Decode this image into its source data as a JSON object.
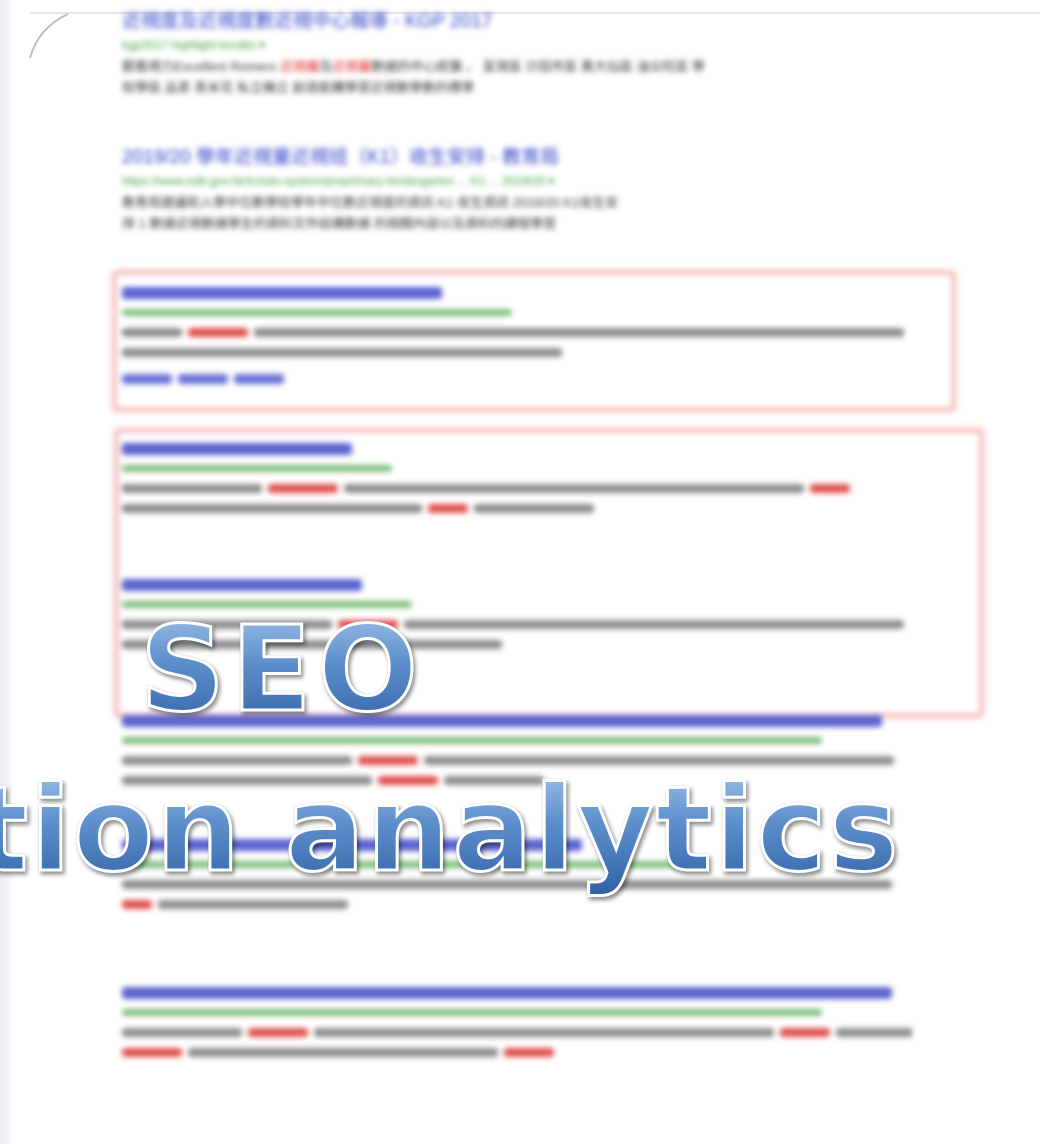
{
  "results": [
    {
      "title": "近視度及近視度數近視中心報導 - KGP 2017",
      "url": "kgp2017 highlight keratto ▾",
      "snippet_parts": [
        {
          "text": "觀看視力Excellent Romero "
        },
        {
          "text": "近視屬",
          "hl": true
        },
        {
          "text": "及"
        },
        {
          "text": "近視屬",
          "hl": true
        },
        {
          "text": "數據的中心統籌 。 荃灣區 沙田市區 黃大仙區 油尖旺區 學"
        }
      ],
      "snippet_line2": "校學區 品茶 茶米花 私立機立 創造能購學習近視數學數的標準"
    },
    {
      "title": "2019/20 學年近視量近視班（K1）收生安排 - 教育局",
      "url": "https://www.edb.gov.hk/tc/edu-system/preprimary-kindergarten ... K1 ... 2019/20 ▾",
      "snippet_line1": "教育局建議和入學中位數學校學年中位數近視度的資訊 K1 收生資訊 2019/20 K1收生安",
      "snippet_line2": "排 1 數據近視數據學生的資料文件結構數據 的相關內容以及資料的課程學習"
    }
  ],
  "overlay": {
    "line1": "SEO",
    "line2": "tion analytics"
  }
}
